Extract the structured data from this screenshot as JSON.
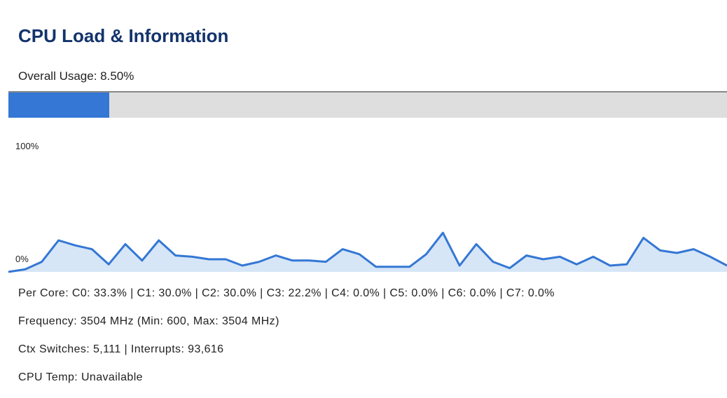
{
  "title": "CPU Load & Information",
  "overall_usage": {
    "label": "Overall Usage: 8.50%",
    "fraction": 0.14
  },
  "colors": {
    "title": "#13336b",
    "accent": "#3477d4",
    "area_fill": "#d6e6f7",
    "track": "#dedede"
  },
  "chart_data": {
    "type": "area",
    "y_max_label": "100%",
    "y_min_label": "0%",
    "ylim": [
      0,
      100
    ],
    "values": [
      0,
      2,
      8,
      25,
      21,
      18,
      6,
      22,
      9,
      25,
      13,
      12,
      10,
      10,
      5,
      8,
      13,
      9,
      9,
      8,
      18,
      14,
      4,
      4,
      4,
      14,
      31,
      5,
      22,
      8,
      3,
      13,
      10,
      12,
      6,
      12,
      5,
      6,
      27,
      17,
      15,
      18,
      12,
      5
    ]
  },
  "per_core": "Per Core: C0: 33.3% | C1: 30.0% | C2: 30.0% | C3: 22.2% | C4: 0.0% | C5: 0.0% | C6: 0.0% | C7: 0.0%",
  "frequency": "Frequency: 3504 MHz (Min: 600, Max: 3504 MHz)",
  "ctx_switches": "Ctx Switches: 5,111 | Interrupts: 93,616",
  "cpu_temp": "CPU Temp: Unavailable"
}
